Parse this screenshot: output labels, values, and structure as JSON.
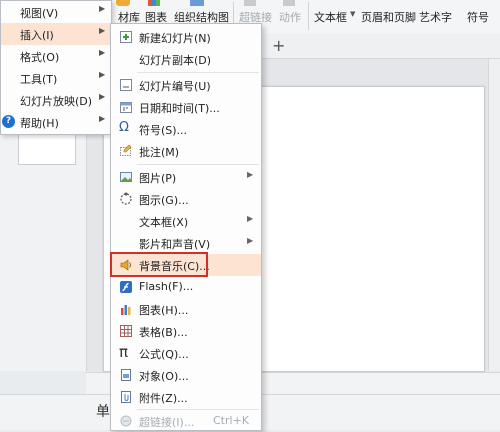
{
  "ribbon": {
    "material_lib": "材库",
    "chart": "图表",
    "org_chart": "组织结构图",
    "hyperlink": "超链接",
    "action": "动作",
    "textbox": "文本框",
    "header_footer": "页眉和页脚",
    "wordart": "艺术字",
    "symbol": "符号"
  },
  "tabstrip": {
    "plus": "+"
  },
  "status": {
    "text": "单"
  },
  "main_menu": {
    "items": [
      {
        "label": "视图(V)"
      },
      {
        "label": "插入(I)"
      },
      {
        "label": "格式(O)"
      },
      {
        "label": "工具(T)"
      },
      {
        "label": "幻灯片放映(D)"
      },
      {
        "label": "帮助(H)"
      }
    ]
  },
  "submenu": {
    "items": [
      {
        "label": "新建幻灯片(N)"
      },
      {
        "label": "幻灯片副本(D)"
      },
      {
        "label": "幻灯片编号(U)"
      },
      {
        "label": "日期和时间(T)..."
      },
      {
        "label": "符号(S)..."
      },
      {
        "label": "批注(M)"
      },
      {
        "label": "图片(P)"
      },
      {
        "label": "图示(G)..."
      },
      {
        "label": "文本框(X)"
      },
      {
        "label": "影片和声音(V)"
      },
      {
        "label": "背景音乐(C)..."
      },
      {
        "label": "Flash(F)..."
      },
      {
        "label": "图表(H)..."
      },
      {
        "label": "表格(B)..."
      },
      {
        "label": "公式(Q)..."
      },
      {
        "label": "对象(O)..."
      },
      {
        "label": "附件(Z)..."
      },
      {
        "label": "超链接(I)...",
        "shortcut": "Ctrl+K"
      }
    ]
  },
  "colors": {
    "highlight": "#fce3d2",
    "callout_border": "#d0302a",
    "accent_blue": "#1d6fd0"
  }
}
